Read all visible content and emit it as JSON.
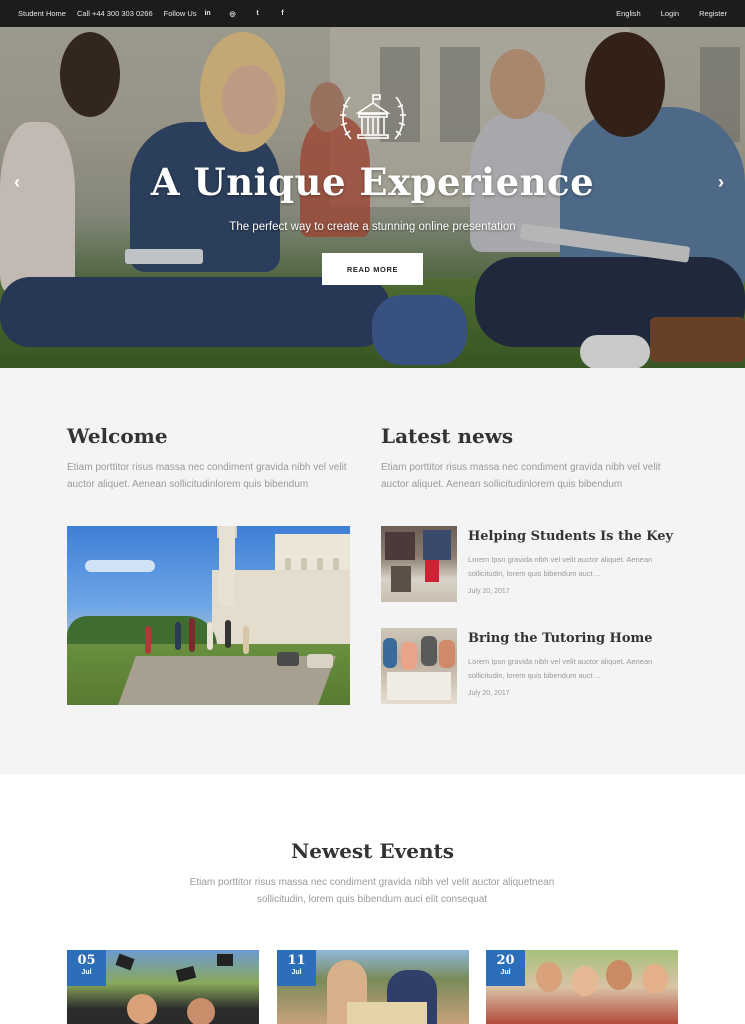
{
  "topbar": {
    "home": "Student Home",
    "phone": "Call +44 300 303 0266",
    "follow": "Follow Us",
    "social_icons": [
      "linkedin-icon",
      "instagram-icon",
      "twitter-icon",
      "facebook-icon"
    ],
    "language": "English",
    "login": "Login",
    "register": "Register"
  },
  "hero": {
    "title": "A Unique Experience",
    "subtitle": "The perfect way to create a stunning online presentation",
    "button": "READ MORE",
    "prev_icon": "chevron-left-icon",
    "next_icon": "chevron-right-icon"
  },
  "welcome": {
    "title": "Welcome",
    "text": "Etiam porttitor risus massa nec condiment gravida nibh vel velit auctor aliquet. Aenean sollicitudinlorem quis bibendum"
  },
  "news": {
    "title": "Latest news",
    "text": "Etiam porttitor risus massa nec condiment gravida nibh vel velit auctor aliquet. Aenean sollicitudinlorem quis bibendum",
    "items": [
      {
        "title": "Helping Students Is the Key",
        "text": "Lorem Ipsn gravida nibh vel velit auctor aliquet. Aenean sollicitudin, lorem quis bibendum auct ...",
        "date": "July 20, 2017"
      },
      {
        "title": "Bring the Tutoring Home",
        "text": "Lorem Ipsn gravida nibh vel velit auctor aliquet. Aenean sollicitudin, lorem quis bibendum auct ...",
        "date": "July 20, 2017"
      }
    ]
  },
  "events": {
    "title": "Newest Events",
    "text": "Etiam porttitor risus massa nec condiment gravida nibh vel velit auctor aliquetnean sollicitudin, lorem quis bibendum auci elit consequat",
    "items": [
      {
        "day": "05",
        "month": "Jul"
      },
      {
        "day": "11",
        "month": "Jul"
      },
      {
        "day": "20",
        "month": "Jul"
      }
    ]
  },
  "colors": {
    "topbar": "#1c1c1c",
    "accent": "#2c6fb8",
    "section_bg": "#f4f4f4"
  }
}
